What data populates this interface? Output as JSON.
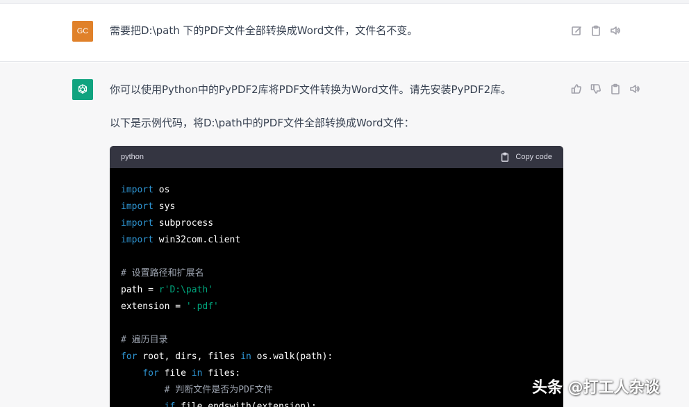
{
  "user_message": {
    "avatar_initials": "GC",
    "avatar_color": "#e0812a",
    "text": "需要把D:\\path 下的PDF文件全部转换成Word文件，文件名不变。",
    "actions": [
      "edit-icon",
      "clipboard-icon",
      "speaker-icon"
    ]
  },
  "assistant_message": {
    "avatar_color": "#10a37f",
    "paragraph_1": "你可以使用Python中的PyPDF2库将PDF文件转换为Word文件。请先安装PyPDF2库。",
    "paragraph_2": "以下是示例代码，将D:\\path中的PDF文件全部转换成Word文件：",
    "actions": [
      "thumbs-up-icon",
      "thumbs-down-icon",
      "clipboard-icon",
      "speaker-icon"
    ]
  },
  "code_block": {
    "language": "python",
    "copy_label": "Copy code",
    "lines": [
      [
        {
          "t": "import",
          "c": "kw"
        },
        {
          "t": " os",
          "c": ""
        }
      ],
      [
        {
          "t": "import",
          "c": "kw"
        },
        {
          "t": " sys",
          "c": ""
        }
      ],
      [
        {
          "t": "import",
          "c": "kw"
        },
        {
          "t": " subprocess",
          "c": ""
        }
      ],
      [
        {
          "t": "import",
          "c": "kw"
        },
        {
          "t": " win32com.client",
          "c": ""
        }
      ],
      [
        {
          "t": "",
          "c": ""
        }
      ],
      [
        {
          "t": "# 设置路径和扩展名",
          "c": "cm"
        }
      ],
      [
        {
          "t": "path = ",
          "c": ""
        },
        {
          "t": "r'D:\\path'",
          "c": "str"
        }
      ],
      [
        {
          "t": "extension = ",
          "c": ""
        },
        {
          "t": "'.pdf'",
          "c": "str"
        }
      ],
      [
        {
          "t": "",
          "c": ""
        }
      ],
      [
        {
          "t": "# 遍历目录",
          "c": "cm"
        }
      ],
      [
        {
          "t": "for",
          "c": "kw"
        },
        {
          "t": " root, dirs, files ",
          "c": ""
        },
        {
          "t": "in",
          "c": "kw"
        },
        {
          "t": " os.walk(path):",
          "c": ""
        }
      ],
      [
        {
          "t": "    ",
          "c": ""
        },
        {
          "t": "for",
          "c": "kw"
        },
        {
          "t": " file ",
          "c": ""
        },
        {
          "t": "in",
          "c": "kw"
        },
        {
          "t": " files:",
          "c": ""
        }
      ],
      [
        {
          "t": "        ",
          "c": ""
        },
        {
          "t": "# 判断文件是否为PDF文件",
          "c": "cm"
        }
      ],
      [
        {
          "t": "        ",
          "c": ""
        },
        {
          "t": "if",
          "c": "kw"
        },
        {
          "t": " file.endswith(extension):",
          "c": ""
        }
      ]
    ]
  },
  "watermark": "头条 @打工人杂谈"
}
